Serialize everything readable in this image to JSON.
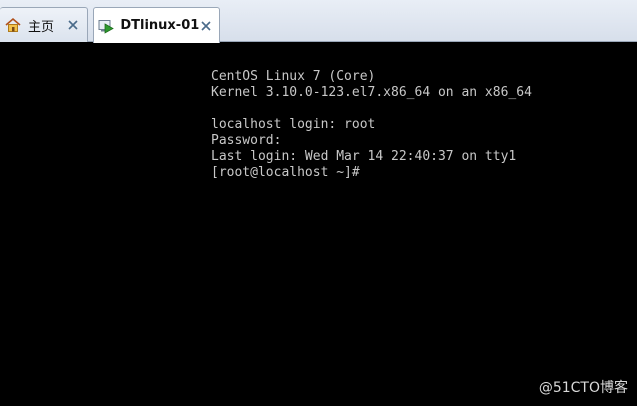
{
  "tabs": [
    {
      "label": "主页",
      "icon": "home-icon"
    },
    {
      "label": "DTlinux-01",
      "icon": "vm-play-icon"
    }
  ],
  "terminal": {
    "lines": [
      "CentOS Linux 7 (Core)",
      "Kernel 3.10.0-123.el7.x86_64 on an x86_64",
      "",
      "localhost login: root",
      "Password:",
      "Last login: Wed Mar 14 22:40:37 on tty1",
      "[root@localhost ~]#"
    ]
  },
  "watermark": "@51CTO博客",
  "colors": {
    "terminal_bg": "#000000",
    "terminal_text": "#c8c8c8",
    "tabbar_bg": "#dbe3ee",
    "active_tab_bg": "#ffffff",
    "close_x": "#4a6b8a"
  }
}
